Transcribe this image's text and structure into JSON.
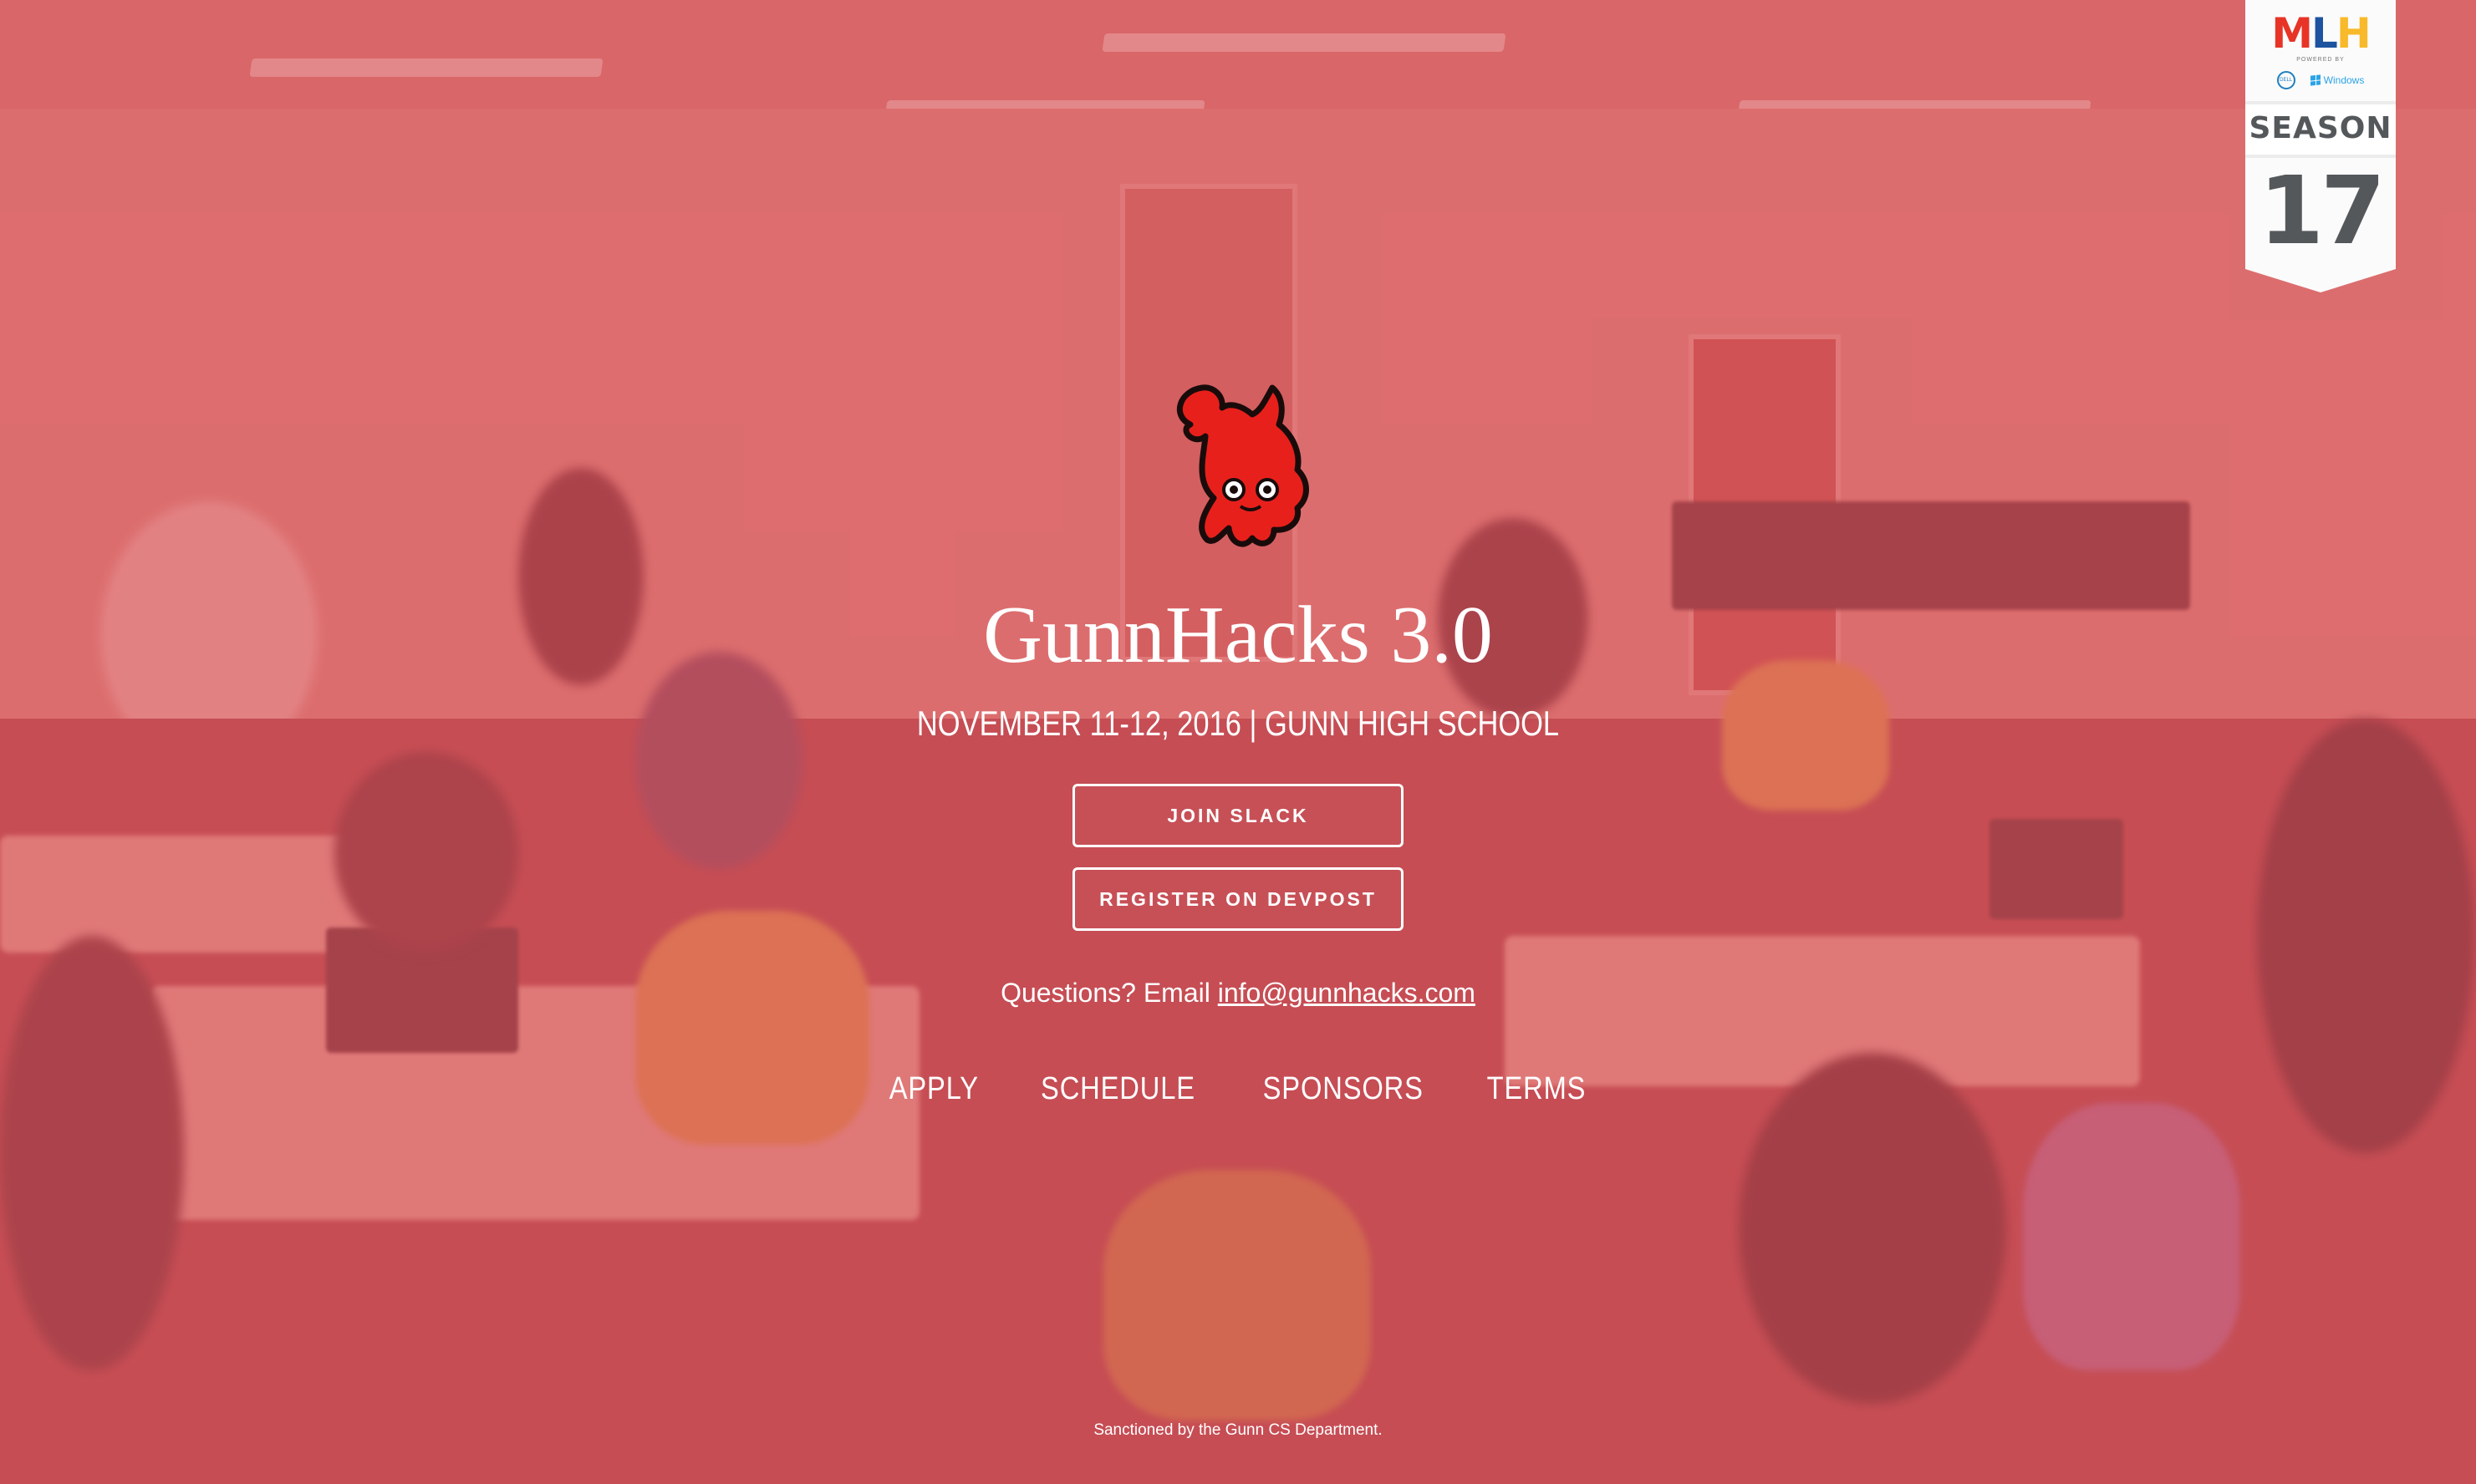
{
  "mlh_badge": {
    "logo_m": "M",
    "logo_l": "L",
    "logo_h": "H",
    "powered_by": "POWERED BY",
    "sponsor_windows": "Windows",
    "season_label": "SEASON",
    "season_number": "17"
  },
  "hero": {
    "mascot_icon": "red-mascot-icon",
    "title": "GunnHacks 3.0",
    "subtitle": "NOVEMBER 11-12, 2016 | GUNN HIGH SCHOOL"
  },
  "actions": {
    "join_slack_label": "JOIN SLACK",
    "register_label": "REGISTER ON DEVPOST"
  },
  "contact": {
    "prefix": "Questions? Email ",
    "email": "info@gunnhacks.com"
  },
  "nav": {
    "items": [
      {
        "label": "APPLY"
      },
      {
        "label": "SCHEDULE"
      },
      {
        "label": "SPONSORS"
      },
      {
        "label": "TERMS"
      }
    ]
  },
  "footer": {
    "text": "Sanctioned by the Gunn CS Department."
  },
  "colors": {
    "overlay": "#d4484e",
    "mascot_red": "#e8201c",
    "mlh_red": "#e73427",
    "mlh_blue": "#1d539f",
    "mlh_yellow": "#f8b92a",
    "badge_gray": "#55585b"
  }
}
